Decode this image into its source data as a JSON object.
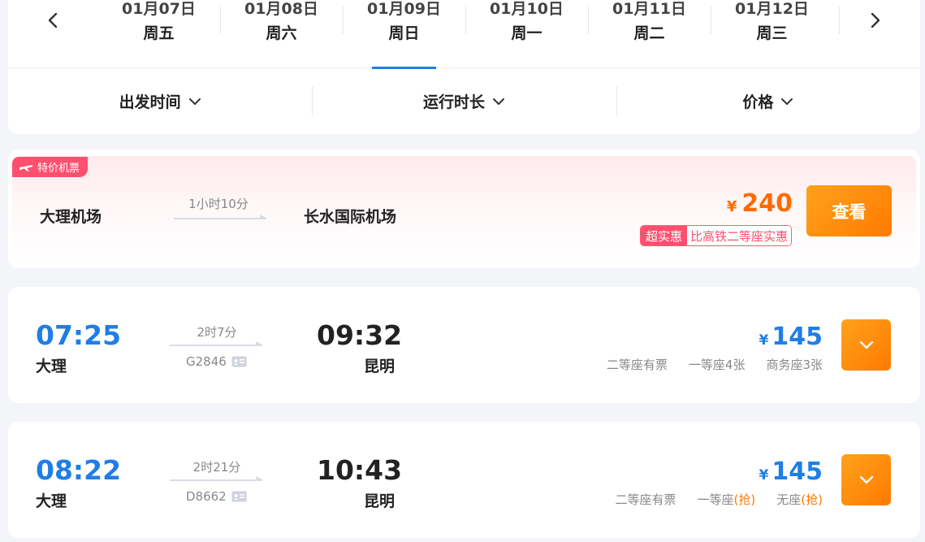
{
  "date_nav": {
    "dates": [
      {
        "day": "01月07日",
        "weekday": "周五",
        "active": false
      },
      {
        "day": "01月08日",
        "weekday": "周六",
        "active": false
      },
      {
        "day": "01月09日",
        "weekday": "周日",
        "active": true
      },
      {
        "day": "01月10日",
        "weekday": "周一",
        "active": false
      },
      {
        "day": "01月11日",
        "weekday": "周二",
        "active": false
      },
      {
        "day": "01月12日",
        "weekday": "周三",
        "active": false
      }
    ]
  },
  "filters": [
    {
      "label": "出发时间",
      "icon": "chevron-down-icon"
    },
    {
      "label": "运行时长",
      "icon": "chevron-down-icon"
    },
    {
      "label": "价格",
      "icon": "chevron-down-icon"
    }
  ],
  "flight_offer": {
    "badge": "特价机票",
    "from": "大理机场",
    "duration": "1小时10分",
    "to": "长水国际机场",
    "currency": "¥",
    "price": "240",
    "tag_primary": "超实惠",
    "tag_secondary": "比高铁二等座实惠",
    "button": "查看"
  },
  "trains": [
    {
      "departure_time": "07:25",
      "departure_station": "大理",
      "duration": "2时7分",
      "train_code": "G2846",
      "arrival_time": "09:32",
      "arrival_station": "昆明",
      "currency": "¥",
      "price": "145",
      "seats": [
        {
          "text": "二等座有票",
          "grab": ""
        },
        {
          "text": "一等座4张",
          "grab": ""
        },
        {
          "text": "商务座3张",
          "grab": ""
        }
      ]
    },
    {
      "departure_time": "08:22",
      "departure_station": "大理",
      "duration": "2时21分",
      "train_code": "D8662",
      "arrival_time": "10:43",
      "arrival_station": "昆明",
      "currency": "¥",
      "price": "145",
      "seats": [
        {
          "text": "二等座有票",
          "grab": ""
        },
        {
          "text": "一等座",
          "grab": "(抢)"
        },
        {
          "text": "无座",
          "grab": "(抢)"
        }
      ]
    }
  ],
  "colors": {
    "accent_blue": "#1f7ee6",
    "accent_orange": "#ff7a00",
    "deal_pink": "#ff4f6e"
  }
}
